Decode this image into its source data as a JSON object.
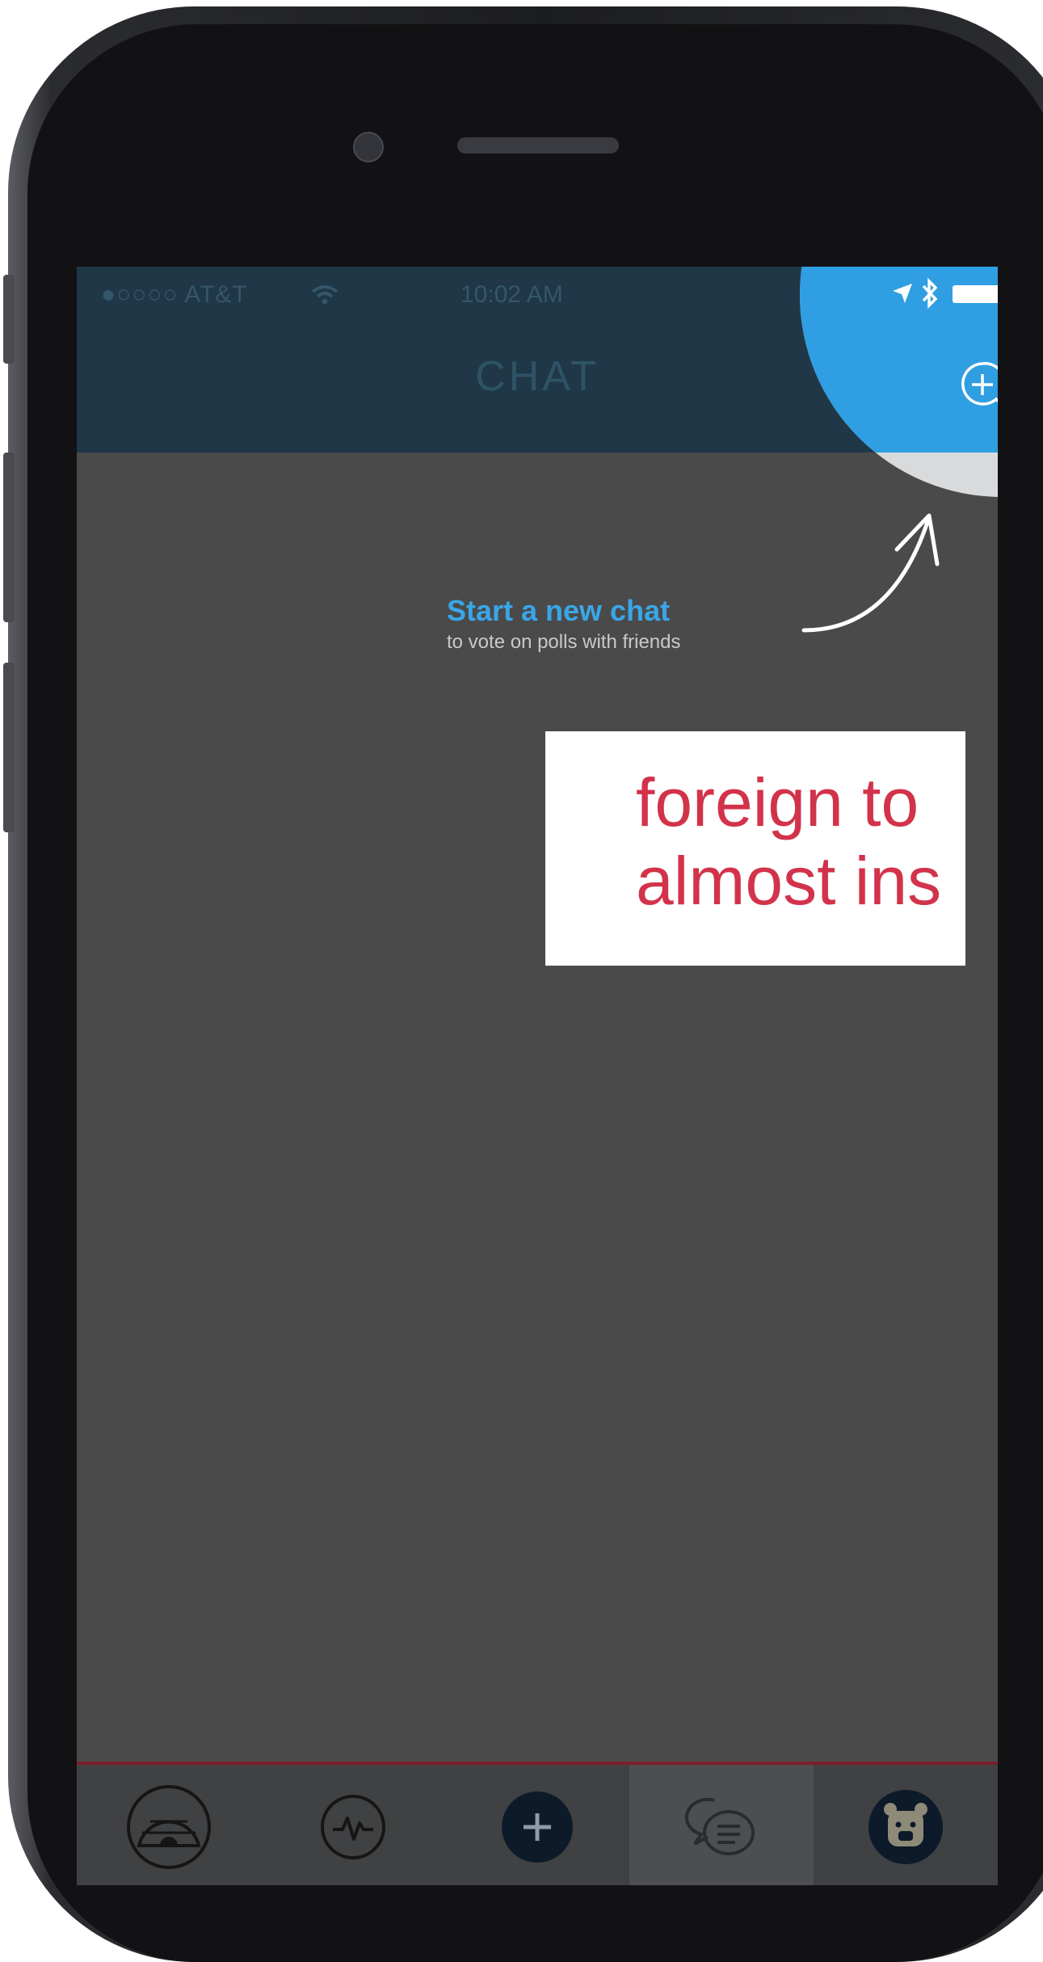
{
  "status_bar": {
    "carrier": "●○○○○ AT&T",
    "time": "10:02 AM"
  },
  "nav": {
    "title": "CHAT",
    "new_chat_icon": "chat-bubble-plus-icon"
  },
  "coach_mark": {
    "title": "Start a new chat",
    "subtitle": "to vote on polls with friends"
  },
  "overlay_caption": {
    "line1": "foreign to",
    "line2": "almost ins"
  },
  "tab_bar": {
    "items": [
      {
        "icon": "igloo-icon",
        "selected": false
      },
      {
        "icon": "activity-icon",
        "selected": false
      },
      {
        "icon": "plus-icon",
        "selected": false
      },
      {
        "icon": "chat-bubbles-icon",
        "selected": true
      },
      {
        "icon": "bear-avatar-icon",
        "selected": false
      }
    ]
  },
  "colors": {
    "accent": "#2f9ee2",
    "nav_bg": "#1f3747",
    "caption": "#d2334a",
    "dim_overlay": "#4a4a4b"
  }
}
